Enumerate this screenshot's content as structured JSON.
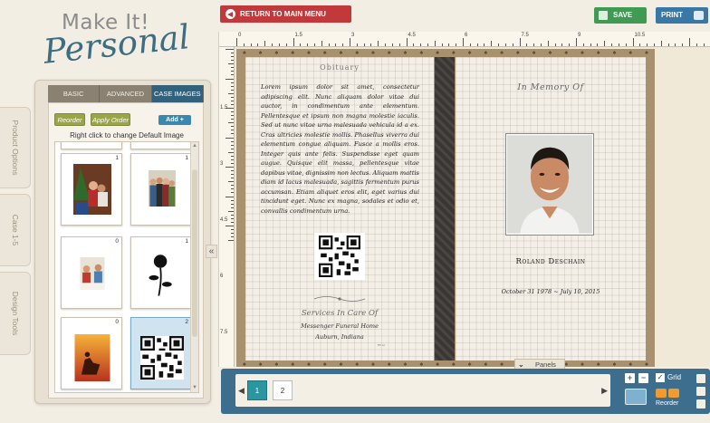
{
  "app": {
    "logo_line1": "Make It!",
    "logo_line2": "Personal",
    "side_tabs": [
      "Product Options",
      "Case 1-5",
      "Design Tools"
    ]
  },
  "panel": {
    "tabs": [
      {
        "label": "BASIC",
        "active": false
      },
      {
        "label": "ADVANCED",
        "active": false
      },
      {
        "label": "CASE IMAGES",
        "active": true
      }
    ],
    "reorder_label": "Reorder",
    "apply_label": "Apply Order",
    "add_label": "Add +",
    "hint": "Right click to change Default Image",
    "thumbnails": [
      {
        "num": "1",
        "icon": "family-christmas-photo"
      },
      {
        "num": "1",
        "icon": "family-group-photo"
      },
      {
        "num": "0",
        "icon": "couple-dinner-photo"
      },
      {
        "num": "1",
        "icon": "rose-silhouette-image"
      },
      {
        "num": "0",
        "icon": "cowboy-sunset-image"
      },
      {
        "num": "2",
        "icon": "qr-code-image"
      }
    ]
  },
  "toolbar": {
    "return_label": "RETURN TO MAIN MENU",
    "save_label": "SAVE",
    "print_label": "PRINT"
  },
  "ruler": {
    "top_labels": [
      "0",
      "1.5",
      "3",
      "4.5",
      "6",
      "7.5",
      "9",
      "10.5"
    ],
    "left_labels": [
      "1.5",
      "3",
      "4.5",
      "6",
      "7.5"
    ]
  },
  "left_page": {
    "title": "Obituary",
    "body": "Lorem ipsum dolor sit amet, consectetur adipiscing elit. Nunc aliquam dolor vitae dui auctor, in condimentum ante elementum. Pellentesque et ipsum non magna molestie iaculis. Sed ut nunc vitae urna malesuada vehicula id a ex. Cras ultricies molestie mollis. Phasellus viverra dui elementum congue aliquam. Fusce a mollis eros. Integer quis ante felis. Suspendisse eget quam augue. Quisque elit massa, pellentesque vitae dapibus vitae, dignissim non lectus. Aliquam mattis diam id lacus malesuada, sagittis fermentum purus accumsan. Etiam aliquet eros elit, eget varius dui tincidunt eget. Nunc ex magna, sodales et odio et, convallis condimentum urna.",
    "services_title": "Services In Care Of",
    "funeral_home": "Messenger Funeral Home",
    "city": "Auburn, Indiana"
  },
  "right_page": {
    "header": "In Memory Of",
    "name": "Roland Deschain",
    "dates": "October 31 1978 ~ July 10, 2015"
  },
  "panels_tab": "Panels",
  "bottom": {
    "pages": [
      "1",
      "2"
    ],
    "grid_label": "Grid",
    "reorder_label": "Reorder"
  },
  "colors": {
    "accent_blue": "#32627b",
    "return_red": "#c1393b",
    "save_green": "#3f9a52",
    "print_blue": "#3978a6",
    "strip_blue": "#3e6e8e",
    "active_page_teal": "#2a96a0"
  }
}
